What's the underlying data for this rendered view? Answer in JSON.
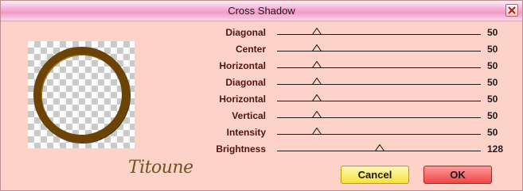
{
  "window": {
    "title": "Cross Shadow"
  },
  "sliders": [
    {
      "label": "Diagonal",
      "value": "50",
      "fraction": 0.196
    },
    {
      "label": "Center",
      "value": "50",
      "fraction": 0.196
    },
    {
      "label": "Horizontal",
      "value": "50",
      "fraction": 0.196
    },
    {
      "label": "Diagonal",
      "value": "50",
      "fraction": 0.196
    },
    {
      "label": "Horizontal",
      "value": "50",
      "fraction": 0.196
    },
    {
      "label": "Vertical",
      "value": "50",
      "fraction": 0.196
    },
    {
      "label": "Intensity",
      "value": "50",
      "fraction": 0.196
    },
    {
      "label": "Brightness",
      "value": "128",
      "fraction": 0.502
    }
  ],
  "buttons": {
    "cancel": "Cancel",
    "ok": "OK"
  },
  "signature": "Titoune",
  "colors": {
    "ring": "#6b4304",
    "background": "#fdd2c8",
    "label_text": "#4f1414"
  }
}
